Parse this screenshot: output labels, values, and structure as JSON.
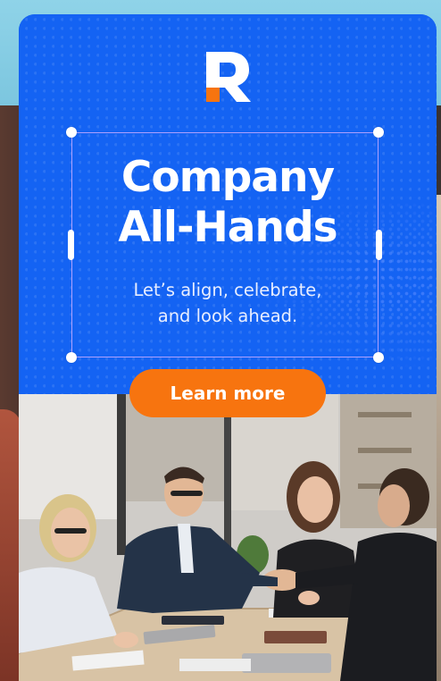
{
  "ad": {
    "title_line1": "Company",
    "title_line2": "All-Hands",
    "subtitle_line1": "Let’s align, celebrate,",
    "subtitle_line2": "and look ahead.",
    "cta_label": "Learn more"
  },
  "logo": {
    "letter": "R",
    "icon": "r-logo-icon"
  },
  "photo": {
    "description_icon": "meeting-photo"
  },
  "colors": {
    "card_blue": "#1463f3",
    "cta_orange": "#f7740f",
    "logo_accent": "#f7740f",
    "text": "#ffffff",
    "frame": "#c8aaff"
  }
}
